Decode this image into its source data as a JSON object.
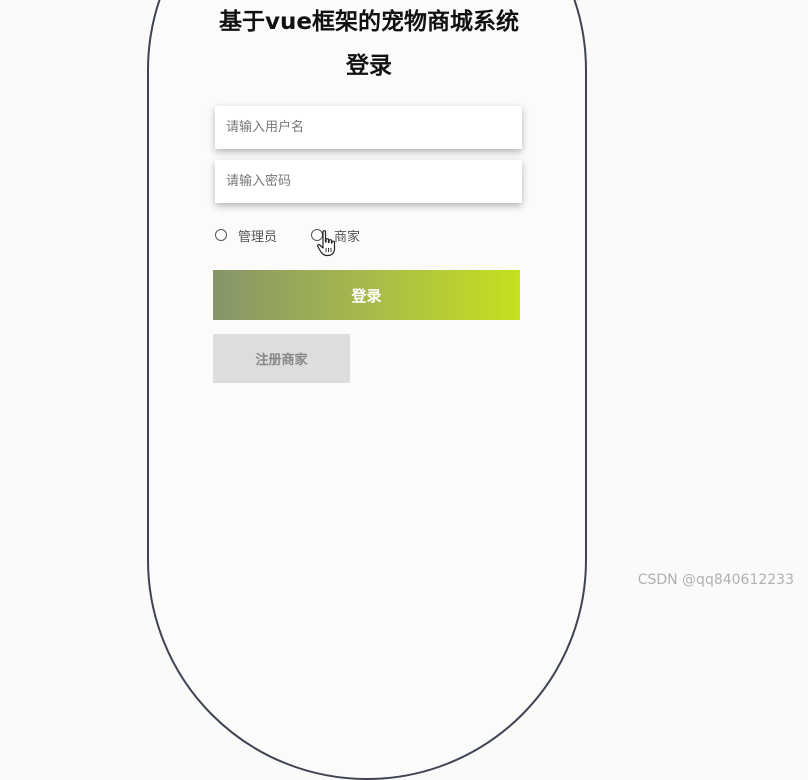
{
  "app": {
    "title": "基于vue框架的宠物商城系统",
    "subtitle": "登录"
  },
  "form": {
    "username": {
      "value": "",
      "placeholder": "请输入用户名"
    },
    "password": {
      "value": "",
      "placeholder": "请输入密码"
    },
    "roles": [
      {
        "label": "管理员",
        "selected": false
      },
      {
        "label": "商家",
        "selected": false
      }
    ],
    "login_label": "登录",
    "register_label": "注册商家"
  },
  "icons": {
    "cursor": "hand-pointer-icon"
  },
  "colors": {
    "border": "#3e4452",
    "login_gradient_start": "#86956a",
    "login_gradient_end": "#c7e020",
    "register_bg": "#dddddd"
  },
  "watermark": "CSDN @qq840612233"
}
